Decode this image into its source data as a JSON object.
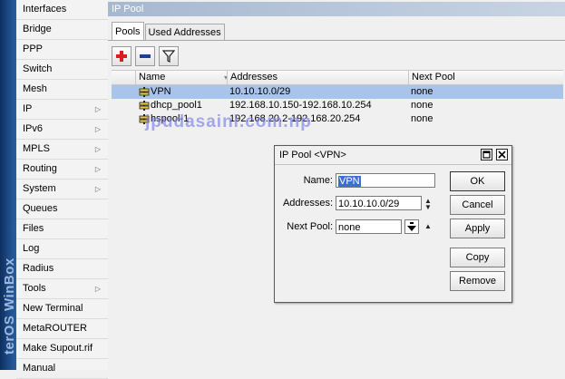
{
  "brand": {
    "text": "terOS WinBox"
  },
  "menu": {
    "items": [
      {
        "label": "Interfaces",
        "submenu": false
      },
      {
        "label": "Bridge",
        "submenu": false
      },
      {
        "label": "PPP",
        "submenu": false
      },
      {
        "label": "Switch",
        "submenu": false
      },
      {
        "label": "Mesh",
        "submenu": false
      },
      {
        "label": "IP",
        "submenu": true
      },
      {
        "label": "IPv6",
        "submenu": true
      },
      {
        "label": "MPLS",
        "submenu": true
      },
      {
        "label": "Routing",
        "submenu": true
      },
      {
        "label": "System",
        "submenu": true
      },
      {
        "label": "Queues",
        "submenu": false
      },
      {
        "label": "Files",
        "submenu": false
      },
      {
        "label": "Log",
        "submenu": false
      },
      {
        "label": "Radius",
        "submenu": false
      },
      {
        "label": "Tools",
        "submenu": true
      },
      {
        "label": "New Terminal",
        "submenu": false
      },
      {
        "label": "MetaROUTER",
        "submenu": false
      },
      {
        "label": "Make Supout.rif",
        "submenu": false
      },
      {
        "label": "Manual",
        "submenu": false
      }
    ]
  },
  "window": {
    "title": "IP Pool",
    "tabs": [
      {
        "label": "Pools",
        "active": true
      },
      {
        "label": "Used Addresses",
        "active": false
      }
    ]
  },
  "toolbar": {
    "add_icon": "plus-icon",
    "remove_icon": "minus-icon",
    "filter_icon": "filter-icon"
  },
  "table": {
    "columns": [
      "",
      "Name",
      "Addresses",
      "Next Pool"
    ],
    "rows": [
      {
        "name": "VPN",
        "addresses": "10.10.10.0/29",
        "next_pool": "none",
        "selected": true
      },
      {
        "name": "dhcp_pool1",
        "addresses": "192.168.10.150-192.168.10.254",
        "next_pool": "none",
        "selected": false
      },
      {
        "name": "hspool-1",
        "addresses": "192.168.20.2-192.168.20.254",
        "next_pool": "none",
        "selected": false
      }
    ]
  },
  "watermark": "jpudasaini.com.np",
  "dialog": {
    "title": "IP Pool <VPN>",
    "name_label": "Name:",
    "name_value": "VPN",
    "addresses_label": "Addresses:",
    "addresses_value": "10.10.10.0/29",
    "next_pool_label": "Next Pool:",
    "next_pool_value": "none",
    "buttons": {
      "ok": "OK",
      "cancel": "Cancel",
      "apply": "Apply",
      "copy": "Copy",
      "remove": "Remove"
    }
  },
  "colors": {
    "selection": "#a9c4ea",
    "title_bar": "#a6b8d0",
    "brand_strip": "#1e4c8a",
    "add": "#d42020",
    "remove": "#1f3f8f"
  }
}
